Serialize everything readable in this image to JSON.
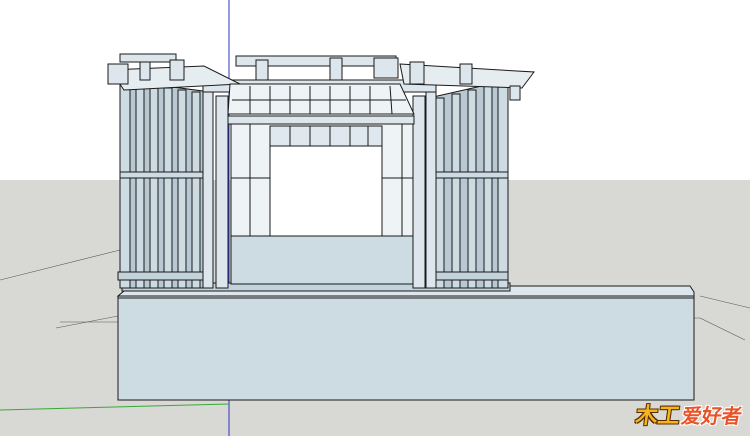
{
  "viewport": {
    "sky_color": "#ffffff",
    "ground_color": "#d8d8d4",
    "frame_fill": "#cddbe3",
    "frame_shade": "#a9bcc7",
    "edge_color": "#1a1a1a",
    "axis_blue": "#2e35c8",
    "axis_red": "#d23a3a",
    "axis_green": "#3aa83a"
  },
  "watermark": {
    "part_a": "木工",
    "part_b": "爱好者"
  }
}
